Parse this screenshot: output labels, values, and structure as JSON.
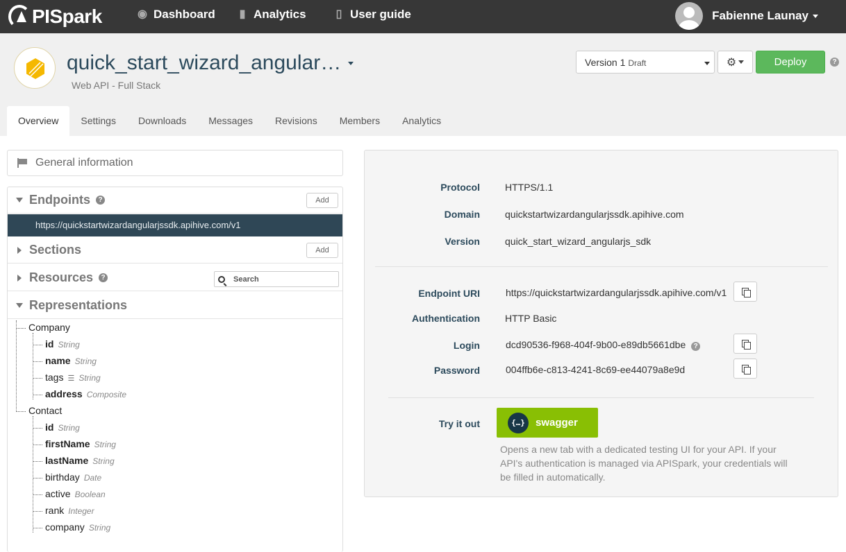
{
  "brand": {
    "logo_text": "PISpark"
  },
  "nav": {
    "dashboard": "Dashboard",
    "analytics": "Analytics",
    "user_guide": "User guide"
  },
  "user": {
    "name": "Fabienne Launay"
  },
  "api": {
    "title": "quick_start_wizard_angular…",
    "subtitle": "Web API - Full Stack"
  },
  "version": {
    "label": "Version 1",
    "status": "Draft"
  },
  "deploy_label": "Deploy",
  "help_glyph": "?",
  "tabs": [
    "Overview",
    "Settings",
    "Downloads",
    "Messages",
    "Revisions",
    "Members",
    "Analytics"
  ],
  "left": {
    "general_information": "General information",
    "endpoints": {
      "title": "Endpoints",
      "add": "Add",
      "items": [
        "https://quickstartwizardangularjssdk.apihive.com/v1"
      ]
    },
    "sections": {
      "title": "Sections",
      "add": "Add"
    },
    "resources": {
      "title": "Resources",
      "search_placeholder": "Search"
    },
    "representations": {
      "title": "Representations",
      "tree": [
        {
          "name": "Company",
          "fields": [
            {
              "name": "id",
              "type": "String",
              "bold": true
            },
            {
              "name": "name",
              "type": "String",
              "bold": true
            },
            {
              "name": "tags",
              "type": "String",
              "bold": false,
              "list": true
            },
            {
              "name": "address",
              "type": "Composite",
              "bold": true
            }
          ]
        },
        {
          "name": "Contact",
          "fields": [
            {
              "name": "id",
              "type": "String",
              "bold": true
            },
            {
              "name": "firstName",
              "type": "String",
              "bold": true
            },
            {
              "name": "lastName",
              "type": "String",
              "bold": true
            },
            {
              "name": "birthday",
              "type": "Date",
              "bold": false
            },
            {
              "name": "active",
              "type": "Boolean",
              "bold": false
            },
            {
              "name": "rank",
              "type": "Integer",
              "bold": false
            },
            {
              "name": "company",
              "type": "String",
              "bold": false
            }
          ]
        }
      ]
    }
  },
  "details": {
    "protocol_label": "Protocol",
    "protocol": "HTTPS/1.1",
    "domain_label": "Domain",
    "domain": "quickstartwizardangularjssdk.apihive.com",
    "version_label": "Version",
    "version": "quick_start_wizard_angularjs_sdk",
    "endpoint_label": "Endpoint URI",
    "endpoint": "https://quickstartwizardangularjssdk.apihive.com/v1",
    "auth_label": "Authentication",
    "auth": "HTTP Basic",
    "login_label": "Login",
    "login": "dcd90536-f968-404f-9b00-e89db5661dbe",
    "password_label": "Password",
    "password": "004ffb6e-c813-4241-8c69-ee44079a8e9d",
    "try_label": "Try it out",
    "swagger_label": "swagger",
    "swagger_logo": "{…}",
    "try_desc": "Opens a new tab with a dedicated testing UI for your API. If your API's authentication is managed via APISpark, your credentials will be filled in automatically."
  },
  "colors": {
    "topbar": "#373737",
    "deploy": "#5cb85c",
    "swagger": "#89bf04",
    "endpoint_selected": "#2f4756",
    "label": "#2c4a5c"
  }
}
